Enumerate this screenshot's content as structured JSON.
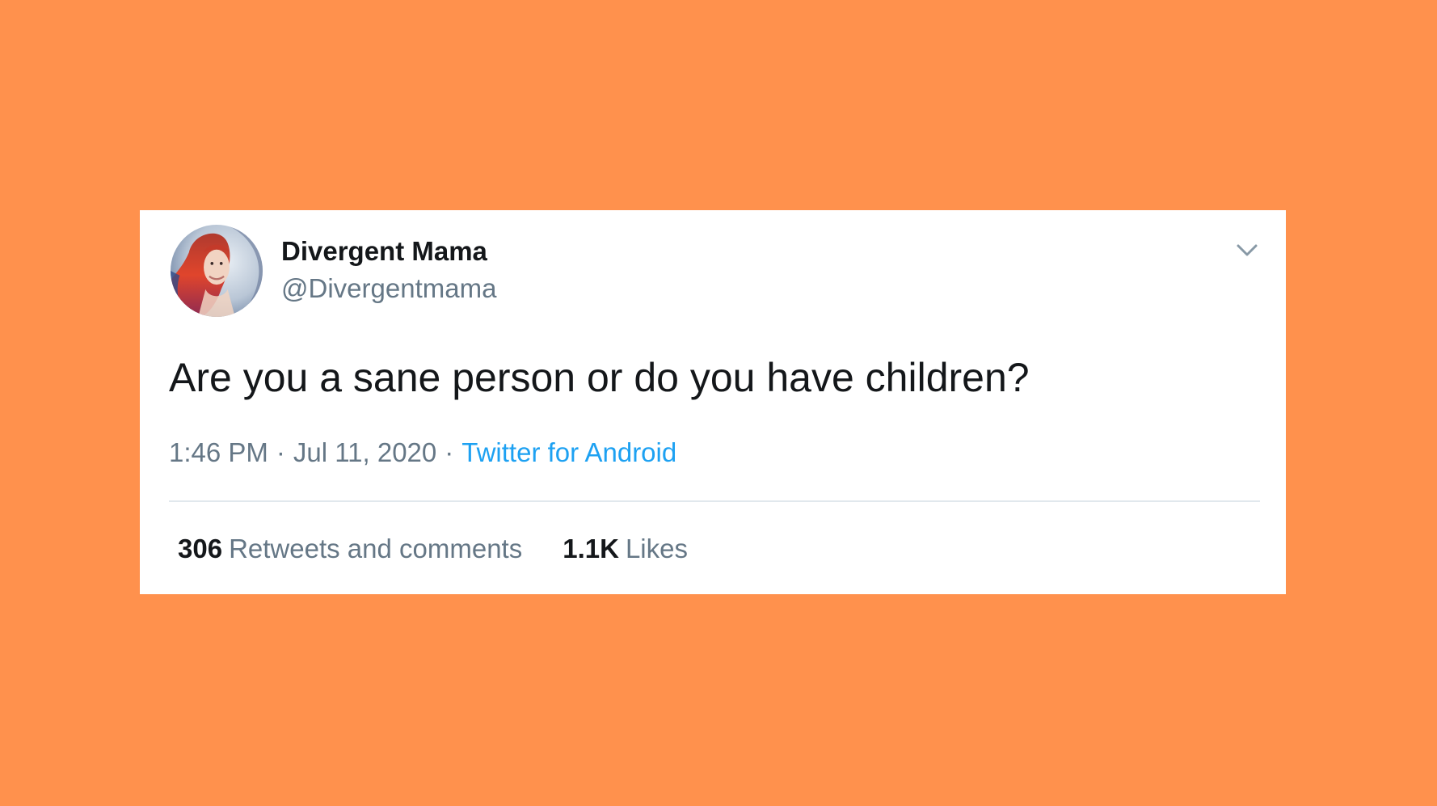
{
  "colors": {
    "background": "#FF914D",
    "card": "#FFFFFF",
    "text_primary": "#14171A",
    "text_secondary": "#657786",
    "link": "#1DA1F2",
    "divider": "#E1E8ED"
  },
  "tweet": {
    "author": {
      "display_name": "Divergent Mama",
      "handle": "@Divergentmama",
      "avatar_icon": "profile-photo"
    },
    "menu_icon": "chevron-down-icon",
    "text": "Are you a sane person or do you have children?",
    "time": "1:46 PM",
    "separator": "·",
    "date": "Jul 11, 2020",
    "source": "Twitter for Android",
    "stats": {
      "retweets_count": "306",
      "retweets_label": "Retweets and comments",
      "likes_count": "1.1K",
      "likes_label": "Likes"
    }
  }
}
